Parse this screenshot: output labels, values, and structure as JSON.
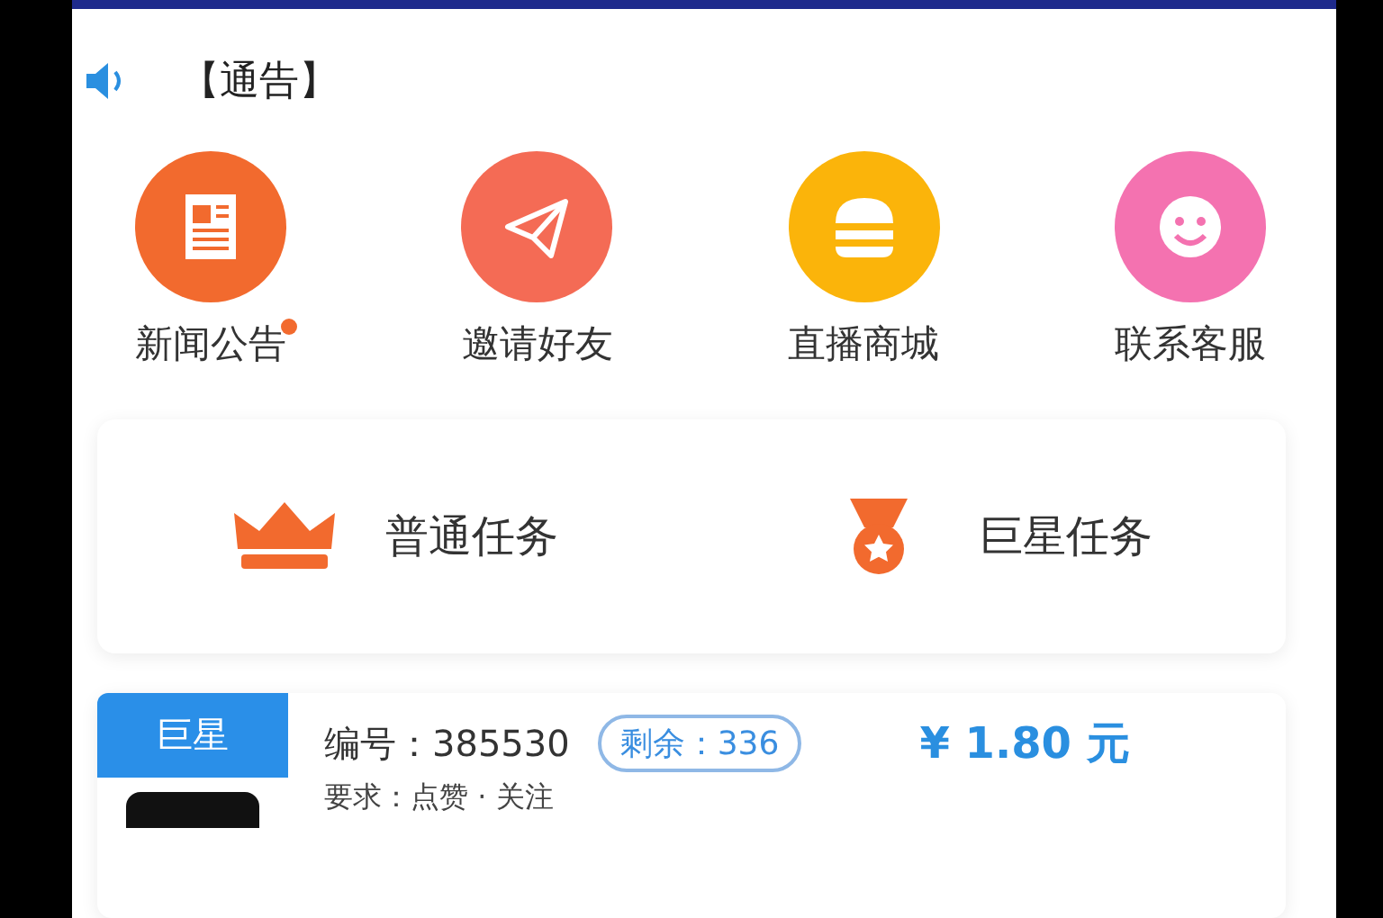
{
  "notice": {
    "label": "【通告】"
  },
  "shortcuts": [
    {
      "kind": "news",
      "label": "新闻公告",
      "color": "#f26a2e",
      "unread": true
    },
    {
      "kind": "invite",
      "label": "邀请好友",
      "color": "#f46b55",
      "unread": false
    },
    {
      "kind": "shop",
      "label": "直播商城",
      "color": "#fbb40a",
      "unread": false
    },
    {
      "kind": "service",
      "label": "联系客服",
      "color": "#f472b0",
      "unread": false
    }
  ],
  "task_types": [
    {
      "kind": "crown",
      "label": "普通任务"
    },
    {
      "kind": "medal",
      "label": "巨星任务"
    }
  ],
  "tasks": [
    {
      "tag": "巨星",
      "number_label": "编号：",
      "number": "385530",
      "remaining": "剩余：336",
      "price": "¥ 1.80 元",
      "requirement": "要求：点赞 · 关注"
    }
  ]
}
